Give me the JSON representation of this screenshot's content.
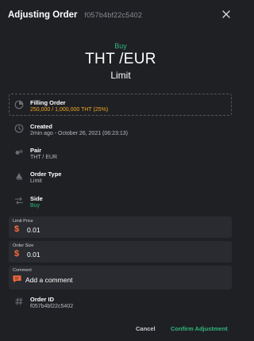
{
  "header": {
    "title": "Adjusting Order",
    "order_id": "f057b4bf22c5402"
  },
  "summary": {
    "side": "Buy",
    "pair": "THT /EUR",
    "type": "Limit"
  },
  "details": {
    "filling": {
      "label": "Filling Order",
      "value": "250,000 / 1,000,000 THT  (25%)"
    },
    "created": {
      "label": "Created",
      "value": "2min ago - October 26, 2021 (06:23:13)"
    },
    "pair": {
      "label": "Pair",
      "value": "THT / EUR"
    },
    "order_type": {
      "label": "Order Type",
      "value": "Limit"
    },
    "side": {
      "label": "Side",
      "value": "Buy"
    }
  },
  "form": {
    "limit_price": {
      "label": "Limit Price",
      "currency_symbol": "$",
      "value": "0.01"
    },
    "order_size": {
      "label": "Order Size",
      "currency_symbol": "$",
      "value": "0.01"
    },
    "comment": {
      "label": "Comment",
      "placeholder": "Add a comment"
    }
  },
  "order_id": {
    "label": "Order ID",
    "value": "f057b4bf22c5402"
  },
  "footer": {
    "cancel_label": "Cancel",
    "confirm_label": "Confirm Adjustment"
  },
  "colors": {
    "background": "#1f2024",
    "accent_green": "#2fb67a",
    "accent_orange": "#f5a623",
    "dollar_red": "#ff6b3d"
  },
  "icons": {
    "close": "close-icon",
    "filling": "progress-icon",
    "created": "clock-icon",
    "pair": "pair-icon",
    "order_type": "order-type-icon",
    "side": "side-arrows-icon",
    "comment": "comment-icon",
    "order_id": "hash-icon"
  }
}
